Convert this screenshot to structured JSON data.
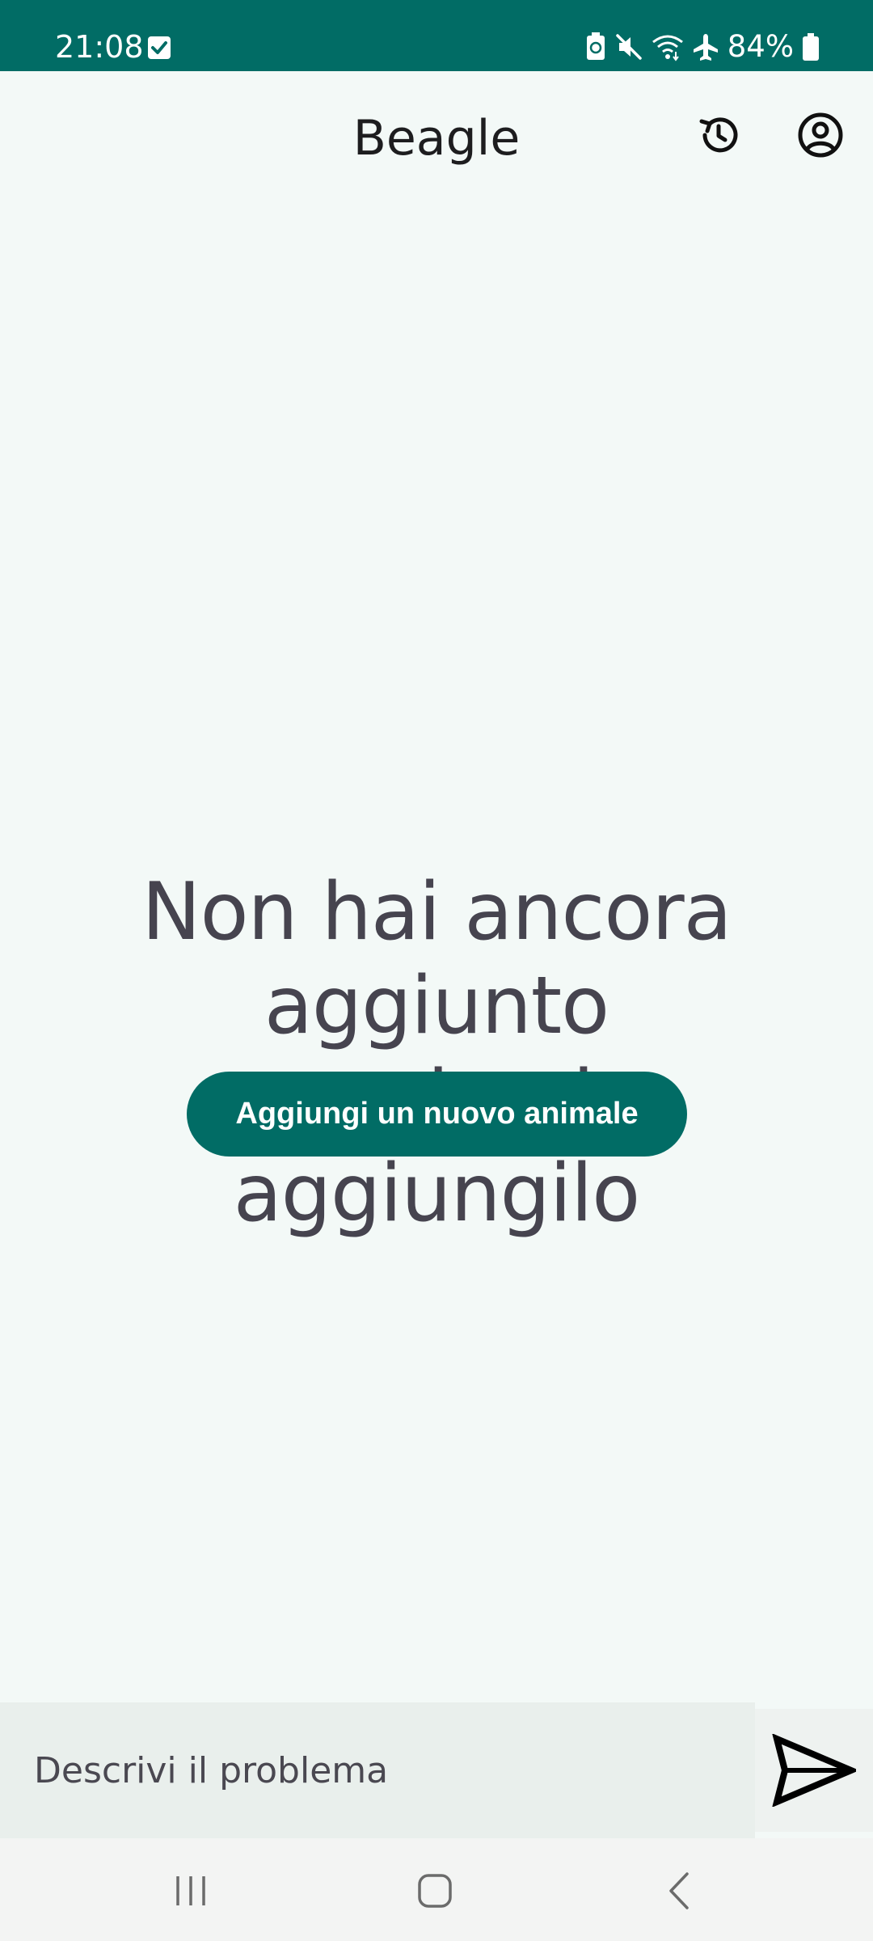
{
  "status_bar": {
    "time": "21:08",
    "battery_percent": "84%",
    "icons": [
      "checkbox-notification-icon",
      "battery-saver-icon",
      "mute-icon",
      "wifi-icon",
      "airplane-mode-icon",
      "battery-icon"
    ],
    "background_color": "#016c65"
  },
  "app_bar": {
    "title": "Beagle",
    "icons": [
      "history-icon",
      "account-circle-icon"
    ]
  },
  "empty_state": {
    "line1": "Non hai ancora aggiunto",
    "line2": "un animale, aggiungilo",
    "button_label": "Aggiungi un nuovo animale"
  },
  "composer": {
    "placeholder": "Descrivi il problema",
    "value": "",
    "send_icon": "send-icon"
  },
  "nav_bar": {
    "icons": [
      "recents-icon",
      "home-icon",
      "back-icon"
    ]
  },
  "colors": {
    "accent": "#016c65",
    "background": "#f3f9f7",
    "text_muted": "#46444f"
  }
}
